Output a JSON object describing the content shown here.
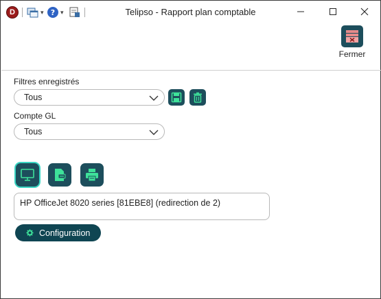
{
  "window": {
    "title": "Telipso - Rapport plan comptable",
    "app_logo_letter": "D"
  },
  "quick_access": {
    "icons": [
      "windows-icon",
      "help-icon",
      "report-icon"
    ]
  },
  "ribbon": {
    "fermer_label": "Fermer"
  },
  "filters": {
    "saved_label": "Filtres enregistrés",
    "saved_value": "Tous",
    "account_label": "Compte GL",
    "account_value": "Tous"
  },
  "output": {
    "options": [
      "screen-icon",
      "pdf-export-icon",
      "printer-icon"
    ],
    "selected": "screen-icon",
    "printer_value": "HP OfficeJet 8020 series [81EBE8] (redirection de 2)"
  },
  "configuration": {
    "label": "Configuration"
  },
  "colors": {
    "accent": "#1d4e5c",
    "accent_dark": "#0f4552",
    "icon_green": "#3ee29a",
    "active_ring": "#39d6c3",
    "logo_red": "#9b1c1c"
  }
}
